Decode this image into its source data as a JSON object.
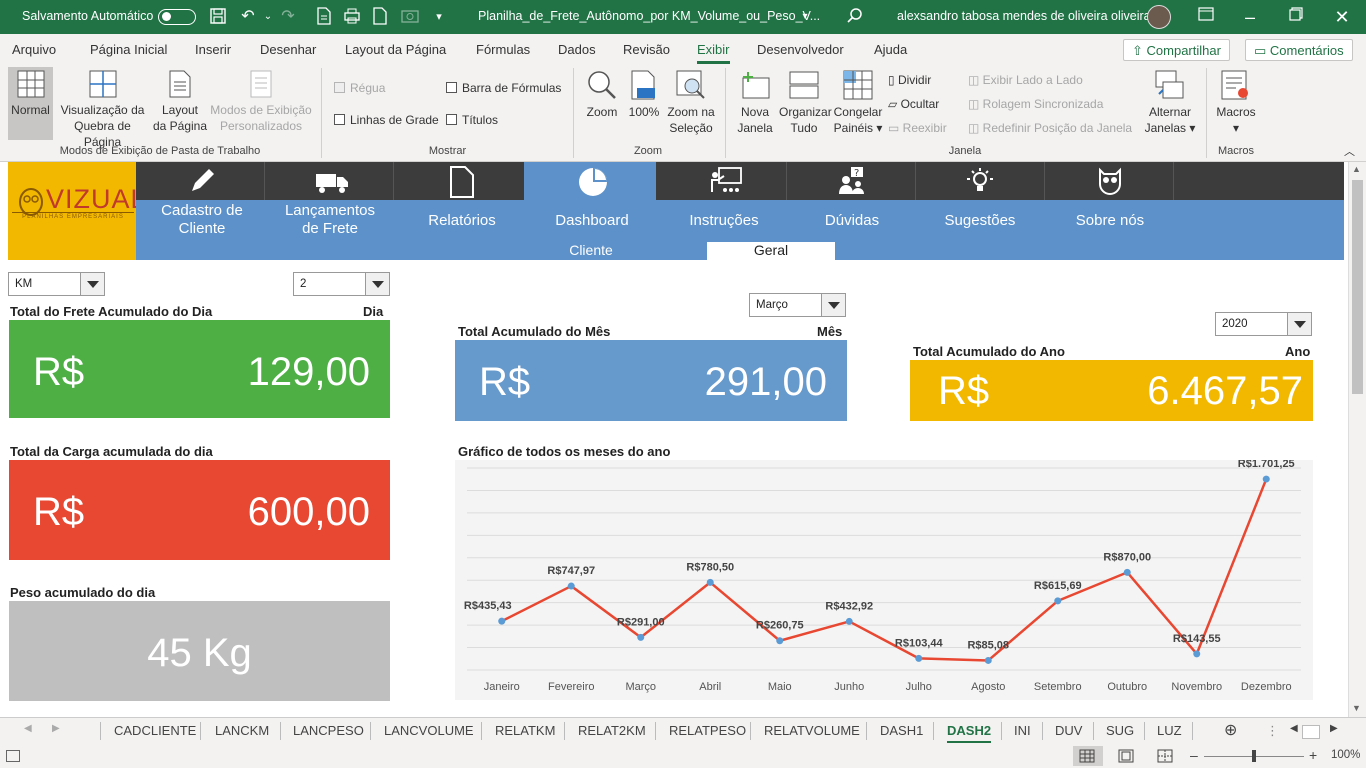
{
  "title_bar": {
    "autosave_label": "Salvamento Automático",
    "file_name": "Planilha_de_Frete_Autônomo_por KM_Volume_ou_Peso_V...",
    "user_name": "alexsandro tabosa mendes de oliveira oliveira"
  },
  "menu": {
    "items": [
      "Arquivo",
      "Página Inicial",
      "Inserir",
      "Desenhar",
      "Layout da Página",
      "Fórmulas",
      "Dados",
      "Revisão",
      "Exibir",
      "Desenvolvedor",
      "Ajuda"
    ],
    "share": "Compartilhar",
    "comments": "Comentários"
  },
  "ribbon": {
    "views": {
      "normal": "Normal",
      "page_break_1": "Visualização da",
      "page_break_2": "Quebra de Página",
      "layout_1": "Layout",
      "layout_2": "da Página",
      "custom_1": "Modos de Exibição",
      "custom_2": "Personalizados",
      "group": "Modos de Exibição de Pasta de Trabalho"
    },
    "show": {
      "ruler": "Régua",
      "gridlines": "Linhas de Grade",
      "formula_bar": "Barra de Fórmulas",
      "headings": "Títulos",
      "group": "Mostrar"
    },
    "zoom": {
      "zoom": "Zoom",
      "hundred": "100%",
      "to_sel_1": "Zoom na",
      "to_sel_2": "Seleção",
      "group": "Zoom"
    },
    "window": {
      "new_1": "Nova",
      "new_2": "Janela",
      "arrange_1": "Organizar",
      "arrange_2": "Tudo",
      "freeze_1": "Congelar",
      "freeze_2": "Painéis",
      "split": "Dividir",
      "hide": "Ocultar",
      "unhide": "Reexibir",
      "side_by_side": "Exibir Lado a Lado",
      "sync_scroll": "Rolagem Sincronizada",
      "reset_pos": "Redefinir Posição da Janela",
      "switch_1": "Alternar",
      "switch_2": "Janelas",
      "group": "Janela"
    },
    "macros": {
      "macros": "Macros",
      "group": "Macros"
    }
  },
  "dashboard": {
    "logo_text": "VIZUAL",
    "logo_sub": "PLANILHAS EMPRESARIAIS",
    "nav": [
      {
        "label_1": "Cadastro de",
        "label_2": "Cliente",
        "icon": "pencil-icon"
      },
      {
        "label_1": "Lançamentos",
        "label_2": "de Frete",
        "icon": "truck-icon"
      },
      {
        "label_1": "Relatórios",
        "label_2": "",
        "icon": "document-icon"
      },
      {
        "label_1": "Dashboard",
        "label_2": "",
        "icon": "pie-chart-icon"
      },
      {
        "label_1": "Instruções",
        "label_2": "",
        "icon": "presentation-icon"
      },
      {
        "label_1": "Dúvidas",
        "label_2": "",
        "icon": "question-user-icon"
      },
      {
        "label_1": "Sugestões",
        "label_2": "",
        "icon": "lightbulb-icon"
      },
      {
        "label_1": "Sobre nós",
        "label_2": "",
        "icon": "owl-icon"
      }
    ],
    "subtabs": {
      "client": "Cliente",
      "general": "Geral"
    },
    "dropdowns": {
      "unit": "KM",
      "day": "2",
      "month": "Março",
      "year": "2020"
    },
    "day_freight": {
      "label": "Total do Frete Acumulado do Dia",
      "tag": "Dia",
      "currency": "R$",
      "value": "129,00",
      "color": "#4eaf45"
    },
    "month_total": {
      "label": "Total Acumulado do Mês",
      "tag": "Mês",
      "currency": "R$",
      "value": "291,00",
      "color": "#6699cc"
    },
    "year_total": {
      "label": "Total Acumulado do Ano",
      "tag": "Ano",
      "currency": "R$",
      "value": "6.467,57",
      "color": "#f2b800"
    },
    "day_load": {
      "label": "Total da Carga acumulada do dia",
      "currency": "R$",
      "value": "600,00",
      "color": "#e84731"
    },
    "day_weight": {
      "label": "Peso acumulado do dia",
      "value": "45 Kg",
      "color": "#bfbfbf"
    },
    "chart_title": "Gráfico de todos os meses do ano"
  },
  "chart_data": {
    "type": "line",
    "title": "Gráfico de todos os meses do ano",
    "categories": [
      "Janeiro",
      "Fevereiro",
      "Março",
      "Abril",
      "Maio",
      "Junho",
      "Julho",
      "Agosto",
      "Setembro",
      "Outubro",
      "Novembro",
      "Dezembro"
    ],
    "values": [
      435.43,
      747.97,
      291.0,
      780.5,
      260.75,
      432.92,
      103.44,
      85.08,
      615.69,
      870.0,
      143.55,
      1701.25
    ],
    "data_labels": [
      "R$435,43",
      "R$747,97",
      "R$291,00",
      "R$780,50",
      "R$260,75",
      "R$432,92",
      "R$103,44",
      "R$85,08",
      "R$615,69",
      "R$870,00",
      "R$143,55",
      "R$1.701,25"
    ],
    "ylim": [
      0,
      1800
    ],
    "grid": true,
    "line_color": "#e84731",
    "marker_color": "#5b9bd5"
  },
  "sheet_tabs": [
    "CADCLIENTE",
    "LANCKM",
    "LANCPESO",
    "LANCVOLUME",
    "RELATKM",
    "RELAT2KM",
    "RELATPESO",
    "RELATVOLUME",
    "DASH1",
    "DASH2",
    "INI",
    "DUV",
    "SUG",
    "LUZ"
  ],
  "active_tab": "DASH2",
  "status": {
    "zoom": "100%"
  }
}
